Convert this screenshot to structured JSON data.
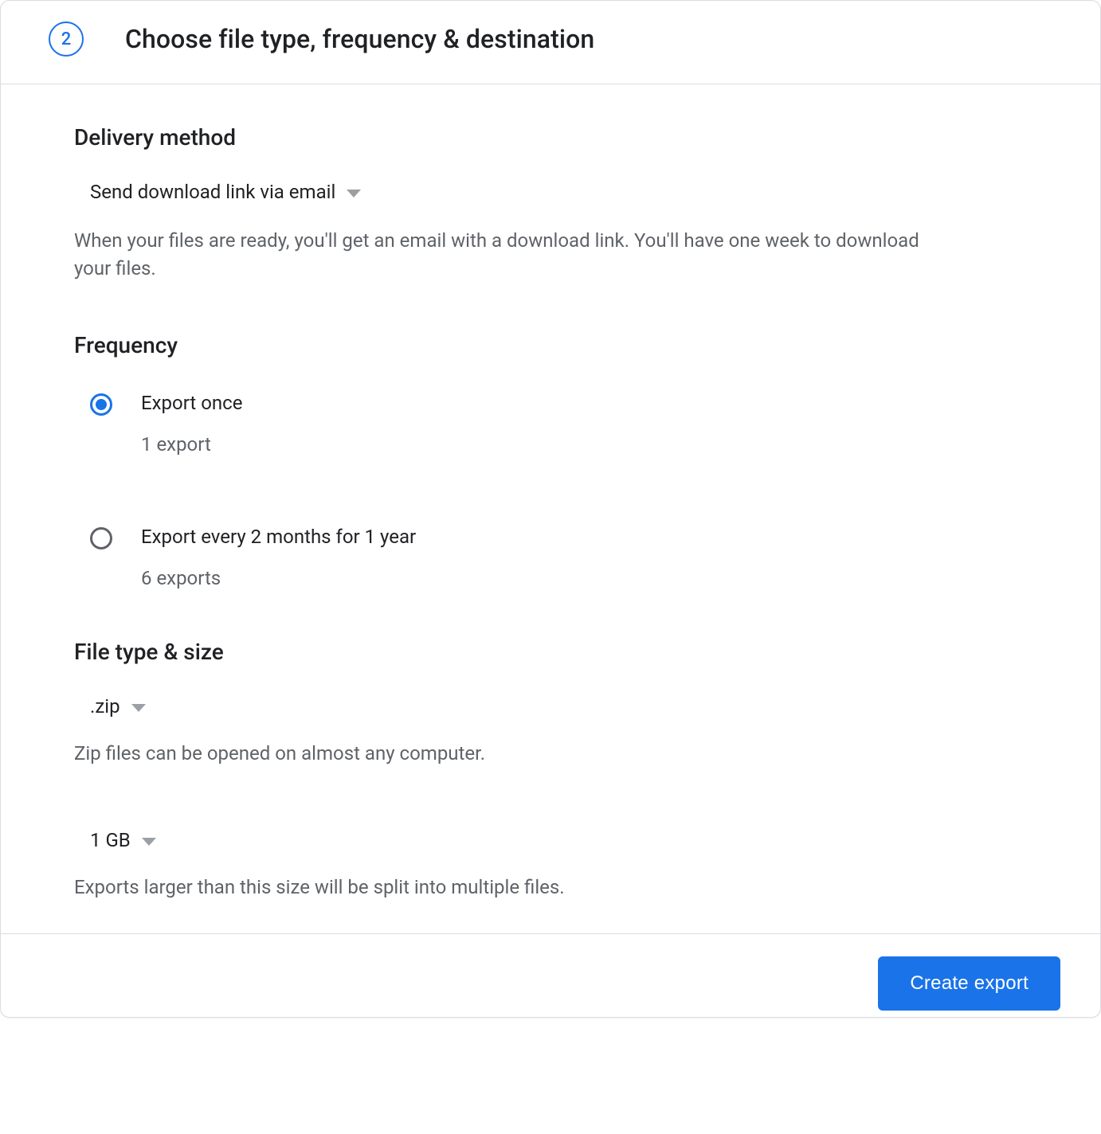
{
  "step": {
    "number": "2",
    "title": "Choose file type, frequency & destination"
  },
  "delivery": {
    "heading": "Delivery method",
    "selected": "Send download link via email",
    "help": "When your files are ready, you'll get an email with a download link. You'll have one week to download your files."
  },
  "frequency": {
    "heading": "Frequency",
    "options": [
      {
        "label": "Export once",
        "sub": "1 export",
        "selected": true
      },
      {
        "label": "Export every 2 months for 1 year",
        "sub": "6 exports",
        "selected": false
      }
    ]
  },
  "filetype": {
    "heading": "File type & size",
    "type_selected": ".zip",
    "type_help": "Zip files can be opened on almost any computer.",
    "size_selected": "1 GB",
    "size_help": "Exports larger than this size will be split into multiple files."
  },
  "actions": {
    "create": "Create export"
  }
}
